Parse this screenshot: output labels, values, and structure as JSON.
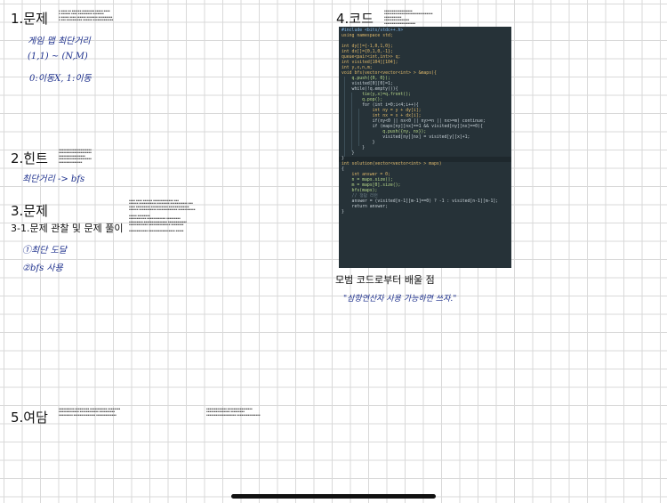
{
  "sections": {
    "s1": {
      "title": "1.문제"
    },
    "s2": {
      "title": "2.힌트"
    },
    "s3": {
      "title": "3.문제",
      "subtitle": "3-1.문제 관찰 및 문제 풀이"
    },
    "s4": {
      "title": "4.코드"
    },
    "s5": {
      "title": "5.여담"
    },
    "learn": {
      "title": "모범 코드로부터 배울 점"
    }
  },
  "handwriting": {
    "s1_line1": "게임 맵 최단거리",
    "s1_line2": "(1,1) ~ (N,M)",
    "s1_line3": "0:이동X, 1:이동",
    "s2_line1": "최단거리 -> bfs",
    "s3_line1": "①최단 도달",
    "s3_line2": "②bfs 사용",
    "learn_line1": "\"삼항연산자 사용 가능하면 쓰자.\""
  },
  "code_lines": [
    "#include <bits/stdc++.h>",
    "using namespace std;",
    "",
    "int dy[]={-1,0,1,0};",
    "int dx[]={0,1,0,-1};",
    "queue<pair<int,int>> q;",
    "int visited[104][104];",
    "int y,x,n,m;",
    "void bfs(vector<vector<int> > &maps){",
    "    q.push({0, 0});",
    "    visited[0][0]=1;",
    "    while(!q.empty()){",
    "        tie(y,x)=q.front();",
    "        q.pop();",
    "        for (int i=0;i<4;i++){",
    "            int ny = y + dy[i];",
    "            int nx = x + dx[i];",
    "            if(ny<0 || nx<0 || ny>=n || nx>=m) continue;",
    "            if (maps[ny][nx]==1 && visited[ny][nx]==0){",
    "                q.push({ny, nx});",
    "                visited[ny][nx] = visited[y][x]+1;",
    "            }",
    "        }",
    "    }",
    "}",
    "int solution(vector<vector<int> > maps)",
    "{",
    "    int answer = 0;",
    "    n = maps.size();",
    "    m = maps[0].size();",
    "    bfs(maps);",
    "    // 정답 리턴",
    "    answer = (visited[n-1][m-1]==0) ? -1 : visited[n-1][m-1];",
    "    return answer;",
    "}"
  ],
  "colors": {
    "code_bg": "#263238",
    "ink_handwriting": "#1c2f8c",
    "grid_line": "#d9d9d9"
  }
}
